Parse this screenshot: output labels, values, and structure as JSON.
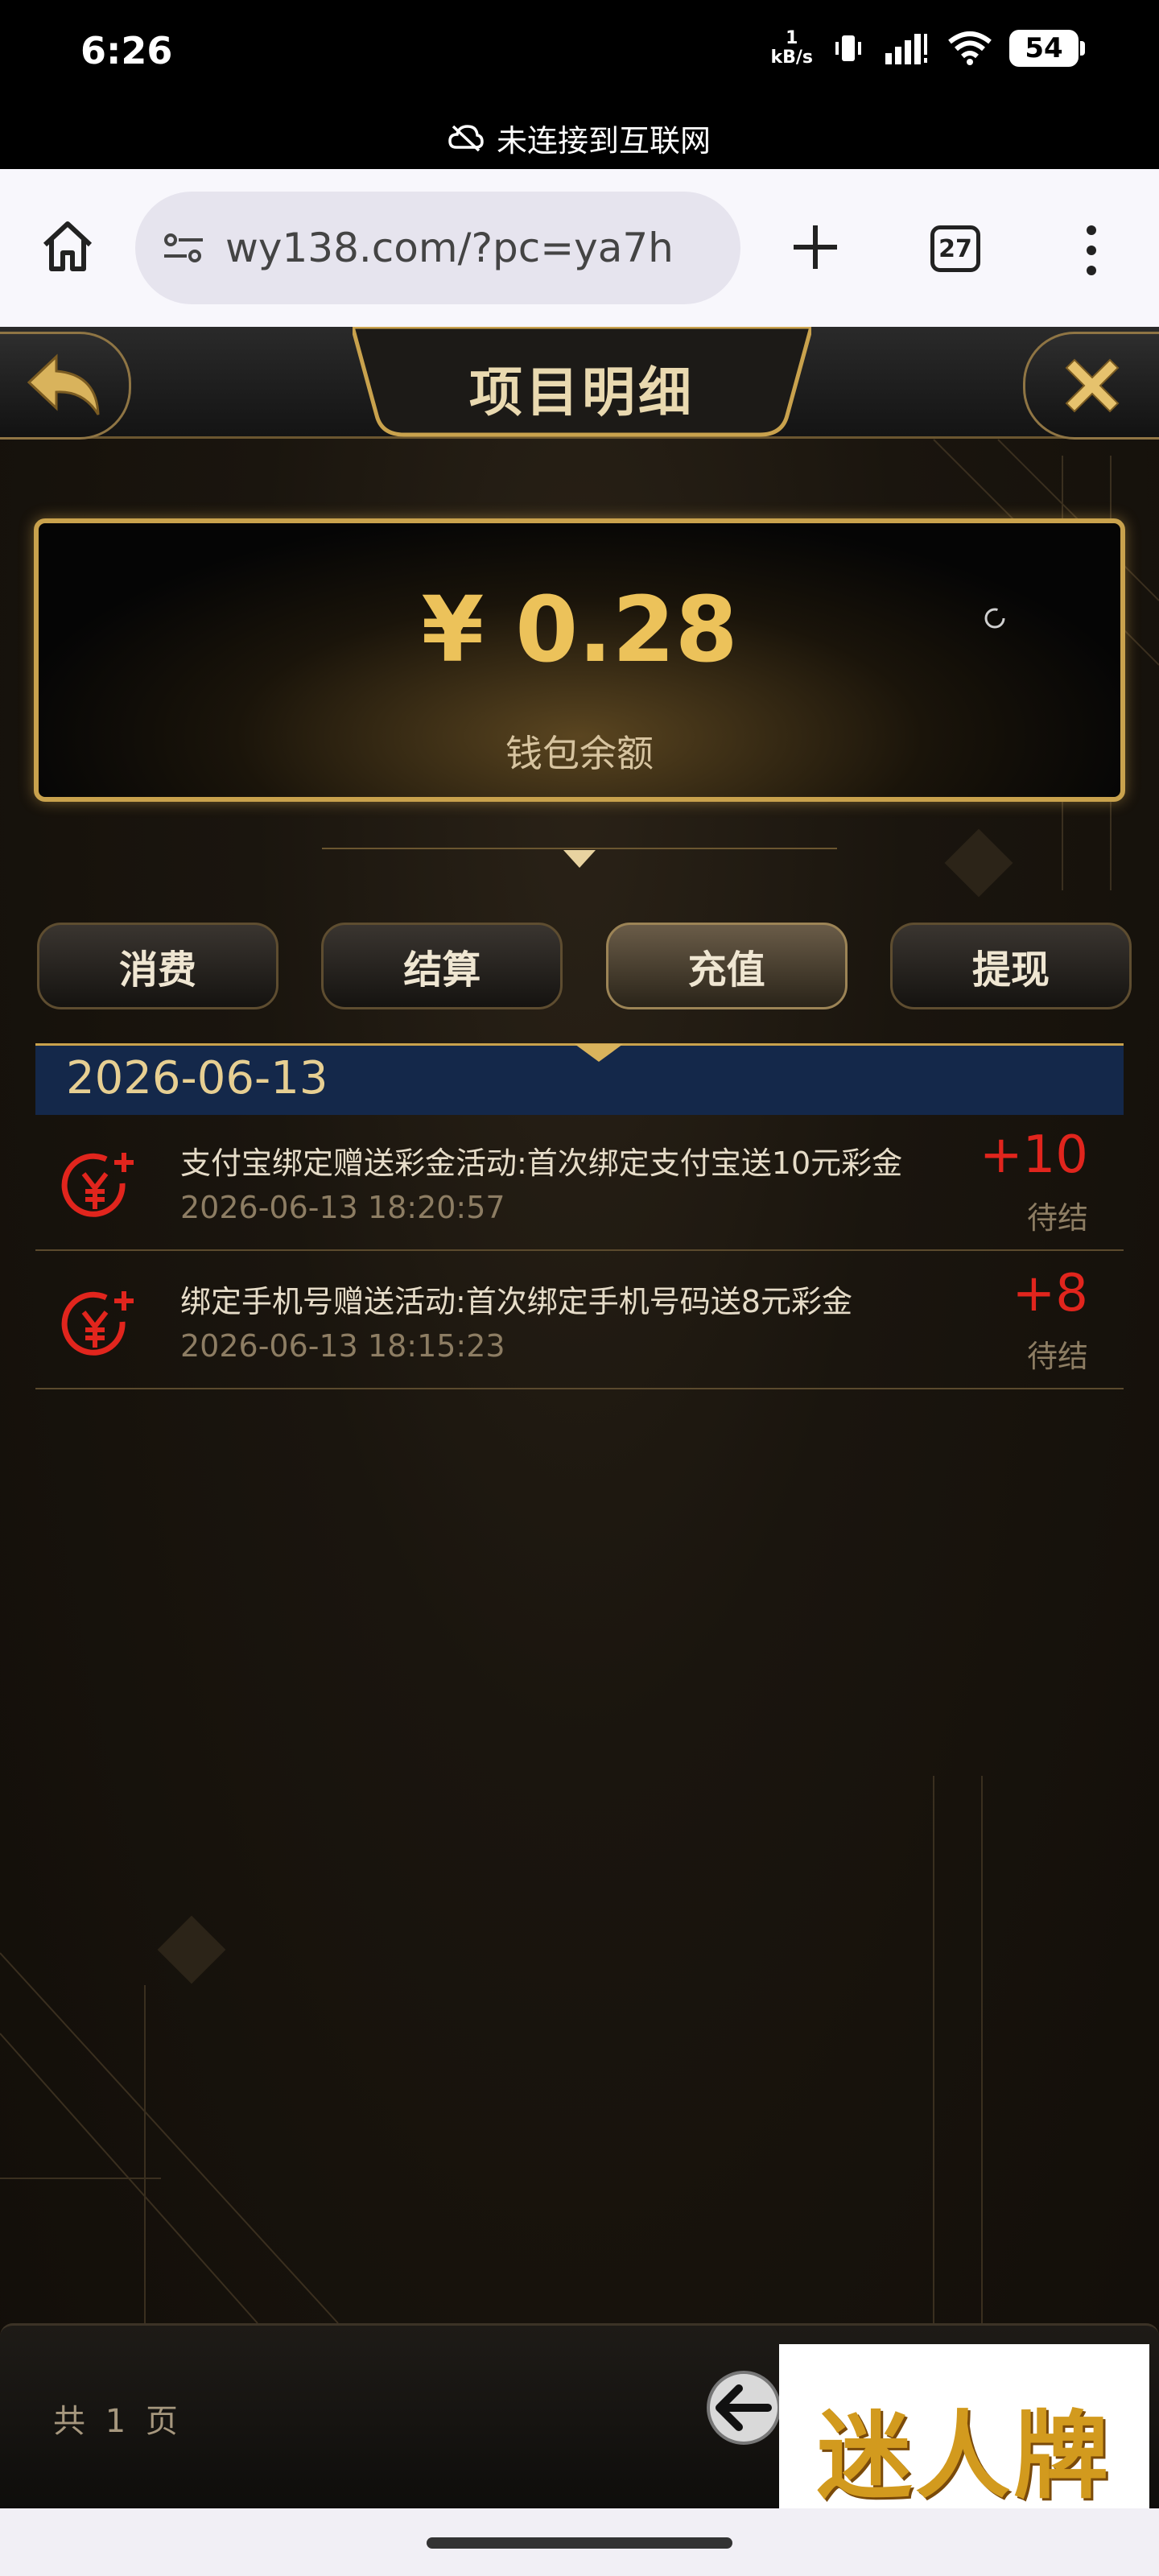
{
  "status_bar": {
    "time": "6:26",
    "net_speed_value": "1",
    "net_speed_unit": "kB/s",
    "battery": "54",
    "offline_notice": "未连接到互联网"
  },
  "browser": {
    "url": "wy138.com/?pc=ya7h",
    "tab_count": "27"
  },
  "page": {
    "title": "项目明细",
    "balance": {
      "value": "¥ 0.28",
      "label": "钱包余额"
    },
    "tabs": [
      {
        "label": "消费",
        "active": false
      },
      {
        "label": "结算",
        "active": false
      },
      {
        "label": "充值",
        "active": true
      },
      {
        "label": "提现",
        "active": false
      }
    ],
    "date_header": "2026-06-13",
    "records": [
      {
        "title": "支付宝绑定赠送彩金活动:首次绑定支付宝送10元彩金",
        "time": "2026-06-13 18:20:57",
        "amount": "+10",
        "status": "待结"
      },
      {
        "title": "绑定手机号赠送活动:首次绑定手机号码送8元彩金",
        "time": "2026-06-13 18:15:23",
        "amount": "+8",
        "status": "待结"
      }
    ],
    "pagination": {
      "text": "共 1 页"
    }
  },
  "watermark": {
    "text": "迷人牌"
  },
  "colors": {
    "gold": "#c9a24d",
    "amount_red": "#e1251d",
    "date_bar_blue": "#14284a"
  }
}
